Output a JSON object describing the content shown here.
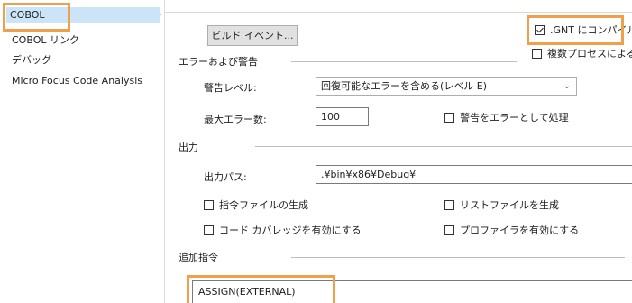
{
  "sidebar": {
    "items": [
      {
        "label": "COBOL",
        "selected": true
      },
      {
        "label": "COBOL リンク"
      },
      {
        "label": "デバッグ"
      },
      {
        "label": "Micro Focus Code Analysis"
      }
    ]
  },
  "build": {
    "build_events_button": "ビルド イベント...",
    "compile_gnt_label": ".GNT にコンパイル",
    "compile_gnt_checked": true,
    "multiprocess_label": "複数プロセスによるコン"
  },
  "errors": {
    "section_title": "エラーおよび警告",
    "warning_level_label": "警告レベル:",
    "warning_level_value": "回復可能なエラーを含める(レベル E)",
    "max_errors_label": "最大エラー数:",
    "max_errors_value": "100",
    "treat_warnings_label": "警告をエラーとして処理"
  },
  "output": {
    "section_title": "出力",
    "path_label": "出力パス:",
    "path_value": ".¥bin¥x86¥Debug¥",
    "gen_directive_file": "指令ファイルの生成",
    "gen_list_file": "リストファイルを生成",
    "enable_coverage": "コード カバレッジを有効にする",
    "enable_profiler": "プロファイラを有効にする"
  },
  "additional": {
    "section_title": "追加指令",
    "directives_value": "ASSIGN(EXTERNAL)"
  },
  "colors": {
    "highlight": "#f0a04b",
    "selection": "#cce4f7"
  }
}
